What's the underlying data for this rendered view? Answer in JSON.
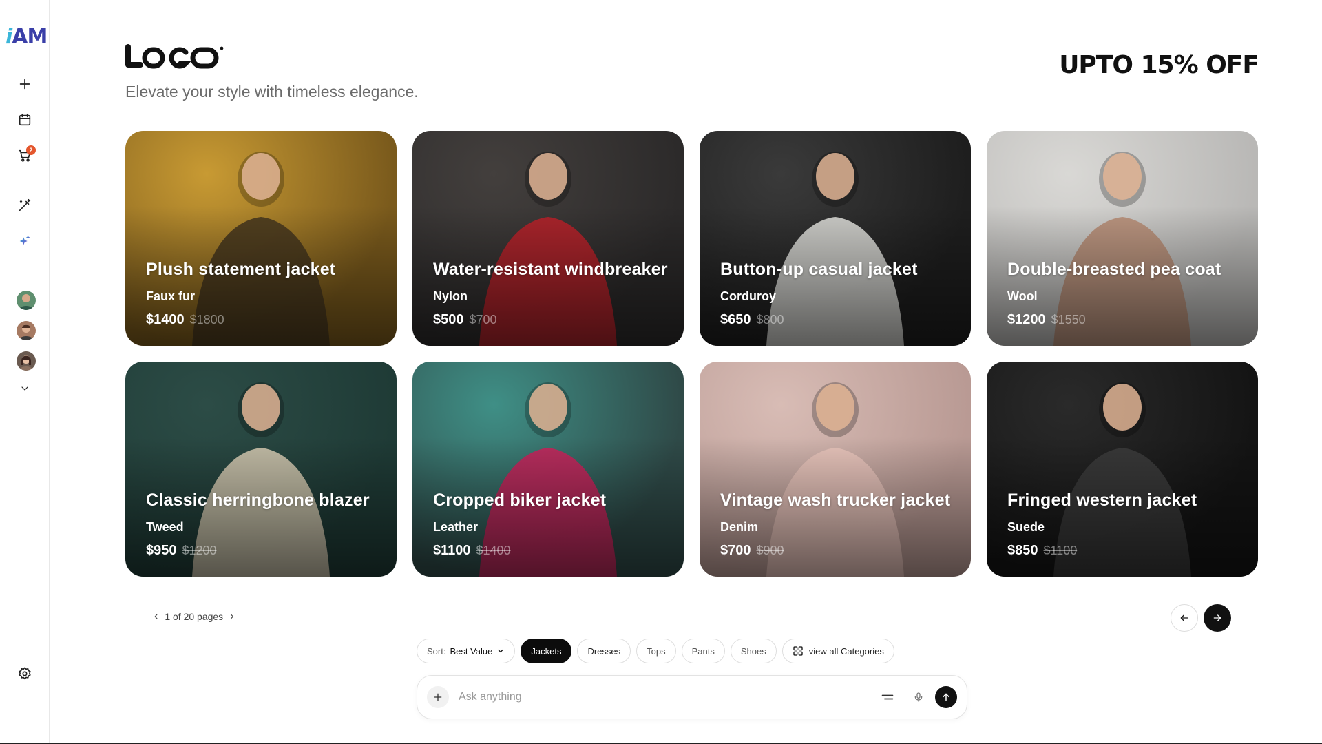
{
  "sidebar": {
    "brand_i": "i",
    "brand_am": "AM",
    "cart_badge": "2",
    "icons": [
      "plus-icon",
      "calendar-icon",
      "cart-icon",
      "magic-wand-icon",
      "sparkles-icon",
      "chevron-down-icon",
      "settings-icon"
    ]
  },
  "header": {
    "logo_text": "LOGO",
    "tagline": "Elevate your style with timeless elegance.",
    "promo": "UPTO 15% OFF"
  },
  "products": [
    {
      "title": "Plush statement jacket",
      "material": "Faux fur",
      "price": "$1400",
      "old_price": "$1800",
      "bg": "#7a5a1c",
      "tone": "#c89a33",
      "fig": "#4a3a1e"
    },
    {
      "title": "Water-resistant windbreaker",
      "material": "Nylon",
      "price": "$500",
      "old_price": "$700",
      "bg": "#2c2a2a",
      "tone": "#433f3d",
      "fig": "#b3232a"
    },
    {
      "title": "Button-up casual jacket",
      "material": "Corduroy",
      "price": "$650",
      "old_price": "$800",
      "bg": "#1e1e1e",
      "tone": "#3a3a3a",
      "fig": "#d8d8d4"
    },
    {
      "title": "Double-breasted pea coat",
      "material": "Wool",
      "price": "$1200",
      "old_price": "$1550",
      "bg": "#b9b8b6",
      "tone": "#d9d8d5",
      "fig": "#b98f78"
    },
    {
      "title": "Classic herringbone blazer",
      "material": "Tweed",
      "price": "$950",
      "old_price": "$1200",
      "bg": "#1f3b36",
      "tone": "#2c4c46",
      "fig": "#cdc4ad"
    },
    {
      "title": "Cropped biker jacket",
      "material": "Leather",
      "price": "$1100",
      "old_price": "$1400",
      "bg": "#2f4a48",
      "tone": "#3f8f86",
      "fig": "#c2275c"
    },
    {
      "title": "Vintage wash trucker jacket",
      "material": "Denim",
      "price": "$700",
      "old_price": "$900",
      "bg": "#b99a94",
      "tone": "#d8bcb5",
      "fig": "#e7c3bb"
    },
    {
      "title": "Fringed western jacket",
      "material": "Suede",
      "price": "$850",
      "old_price": "$1100",
      "bg": "#141414",
      "tone": "#2a2a2a",
      "fig": "#3b3b3b"
    }
  ],
  "pager": {
    "label": "1 of 20 pages"
  },
  "filters": {
    "sort_label": "Sort:",
    "sort_value": "Best Value",
    "chips": [
      "Jackets",
      "Dresses",
      "Tops",
      "Pants",
      "Shoes"
    ],
    "active_chip": "Jackets",
    "view_all": "view all Categories"
  },
  "ask": {
    "placeholder": "Ask anything"
  }
}
